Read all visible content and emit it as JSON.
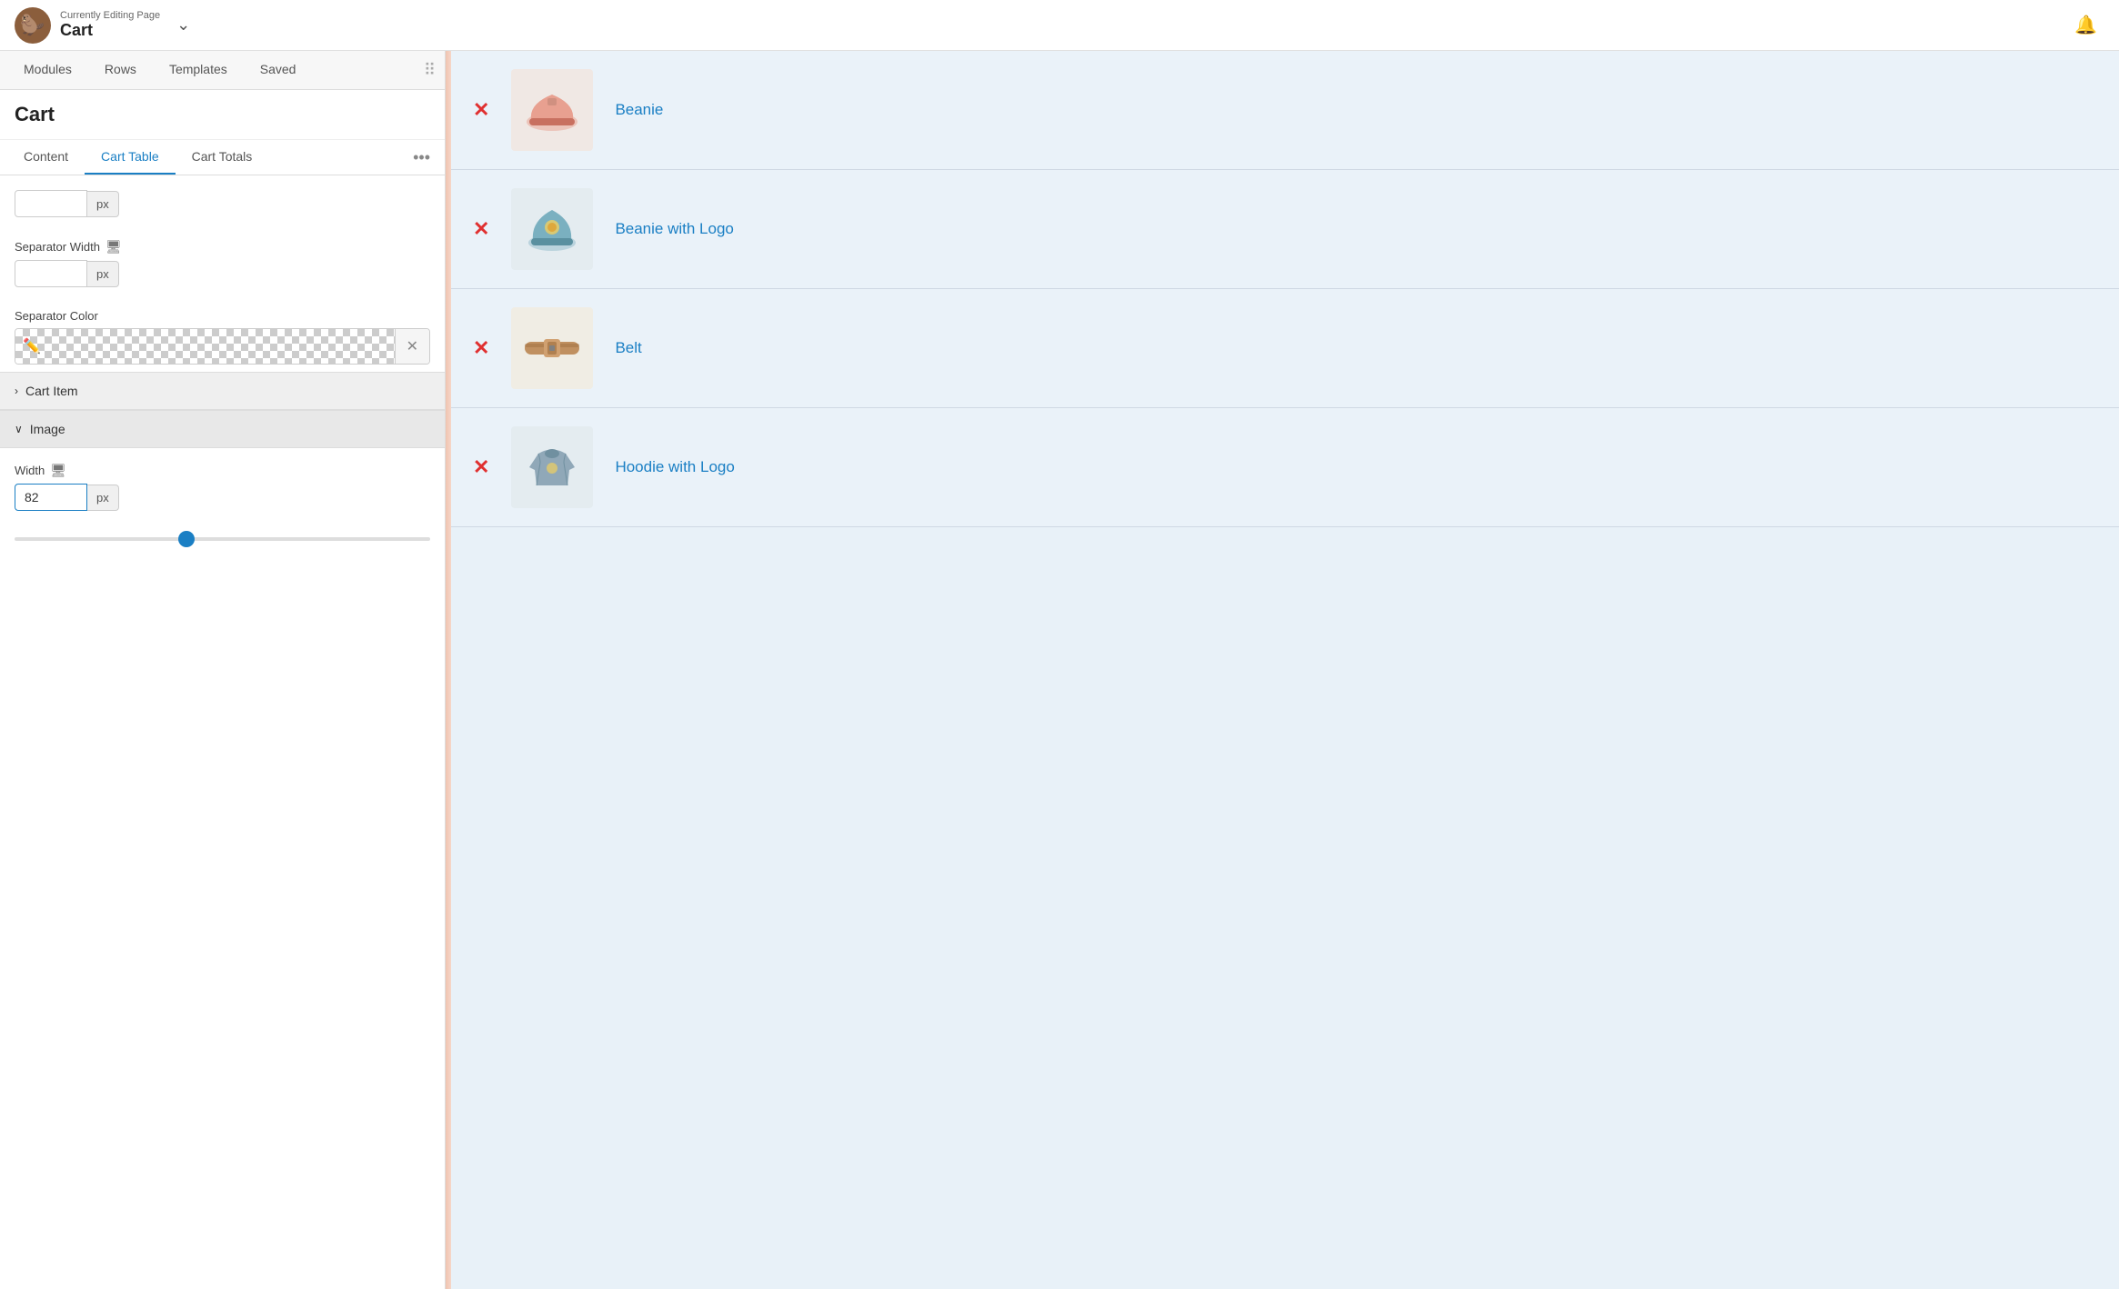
{
  "header": {
    "logo_emoji": "🦫",
    "editing_label": "Currently Editing Page",
    "page_name": "Cart",
    "chevron": "⌄",
    "bell": "🔔"
  },
  "left_panel": {
    "tabs": [
      {
        "id": "modules",
        "label": "Modules",
        "active": false
      },
      {
        "id": "rows",
        "label": "Rows",
        "active": false
      },
      {
        "id": "templates",
        "label": "Templates",
        "active": false
      },
      {
        "id": "saved",
        "label": "Saved",
        "active": false
      }
    ],
    "section_title": "Cart",
    "sub_tabs": [
      {
        "id": "content",
        "label": "Content",
        "active": false
      },
      {
        "id": "cart-table",
        "label": "Cart Table",
        "active": true
      },
      {
        "id": "cart-totals",
        "label": "Cart Totals",
        "active": false
      }
    ],
    "more_label": "•••",
    "separator_width": {
      "label": "Separator Width",
      "value": "",
      "unit": "px"
    },
    "separator_color": {
      "label": "Separator Color"
    },
    "cart_item_section": {
      "label": "Cart Item",
      "collapsed": true,
      "chevron": "›"
    },
    "image_section": {
      "label": "Image",
      "expanded": true,
      "chevron": "∨"
    },
    "width_field": {
      "label": "Width",
      "value": "82",
      "unit": "px"
    },
    "slider_value": 82,
    "slider_max": 200,
    "eyedropper": "✏",
    "clear": "✕"
  },
  "cart_items": [
    {
      "id": 1,
      "name": "Beanie",
      "emoji": "🧢",
      "color": "#e07060"
    },
    {
      "id": 2,
      "name": "Beanie with Logo",
      "emoji": "🧢",
      "color": "#6090a0"
    },
    {
      "id": 3,
      "name": "Belt",
      "emoji": "👜",
      "color": "#b08060"
    },
    {
      "id": 4,
      "name": "Hoodie with Logo",
      "emoji": "🧥",
      "color": "#90a0b0"
    }
  ]
}
